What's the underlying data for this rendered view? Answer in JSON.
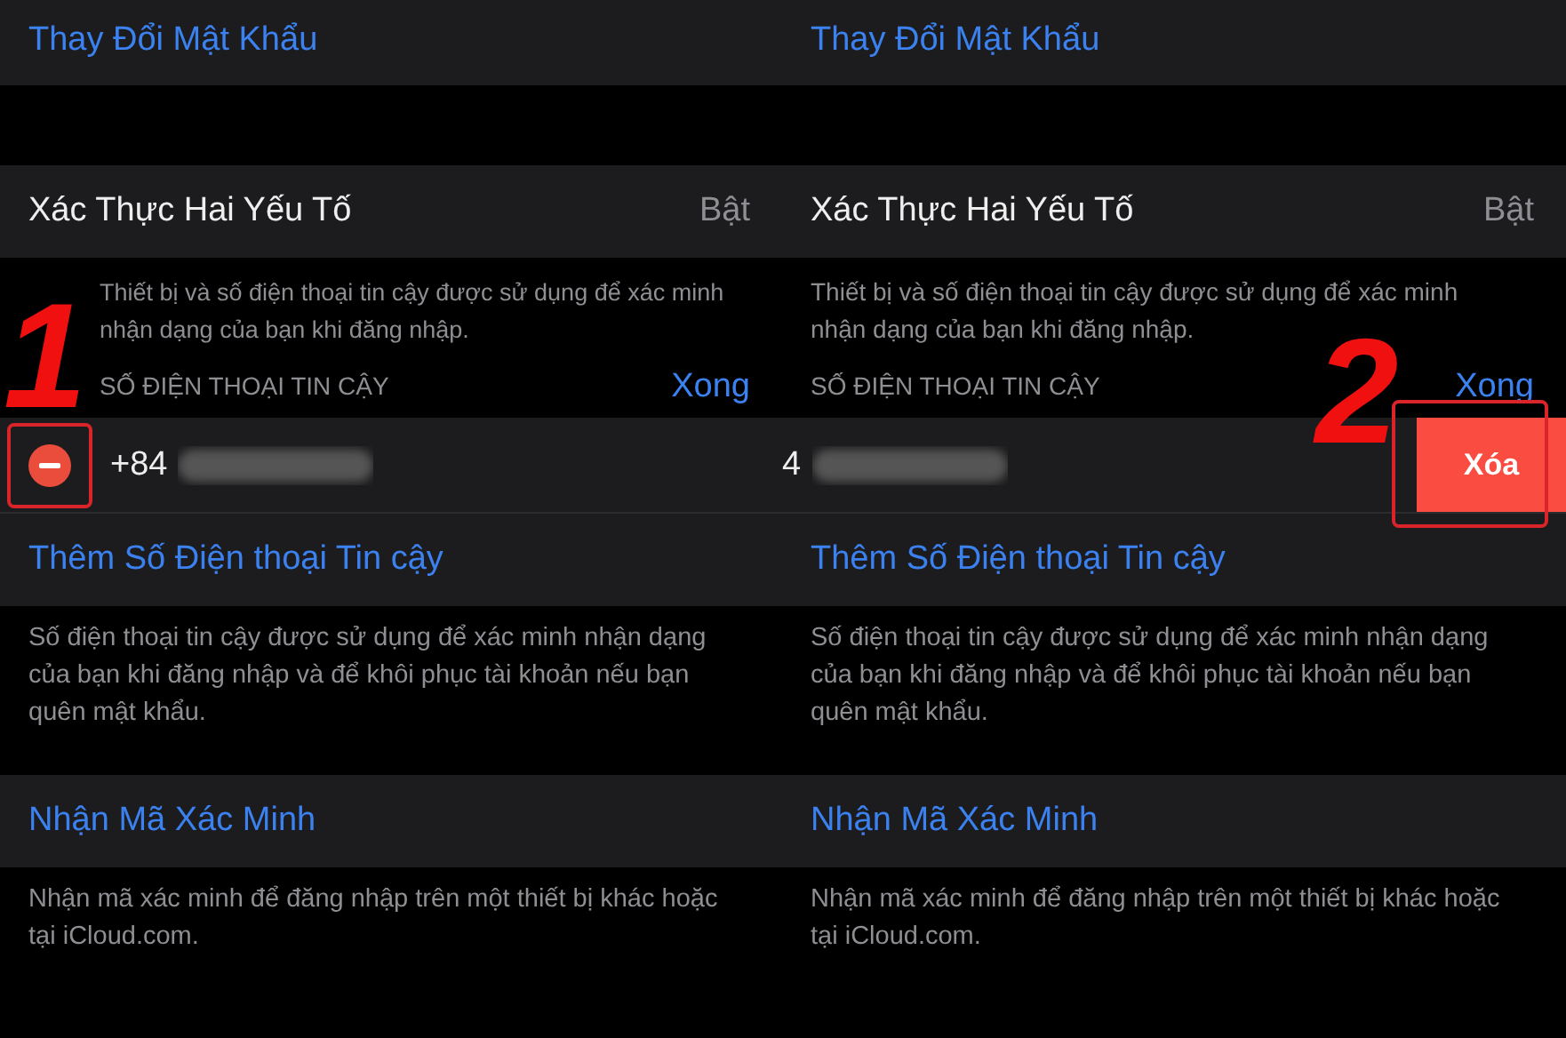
{
  "panels": [
    {
      "annotation": "1",
      "change_password": "Thay Đổi Mật Khẩu",
      "two_factor": {
        "label": "Xác Thực Hai Yếu Tố",
        "value": "Bật"
      },
      "two_factor_note": "Thiết bị và số điện thoại tin cậy được sử dụng để xác minh nhận dạng của bạn khi đăng nhập.",
      "section_header": "SỐ ĐIỆN THOẠI TIN CẬY",
      "done": "Xong",
      "phone_row": {
        "kind": "edit",
        "number": "+84"
      },
      "add_phone": "Thêm Số Điện thoại Tin cậy",
      "add_phone_note": "Số điện thoại tin cậy được sử dụng để xác minh nhận dạng của bạn khi đăng nhập và để khôi phục tài khoản nếu bạn quên mật khẩu.",
      "get_code": "Nhận Mã Xác Minh",
      "get_code_note": "Nhận mã xác minh để đăng nhập trên một thiết bị khác hoặc tại iCloud.com."
    },
    {
      "annotation": "2",
      "change_password": "Thay Đổi Mật Khẩu",
      "two_factor": {
        "label": "Xác Thực Hai Yếu Tố",
        "value": "Bật"
      },
      "two_factor_note": "Thiết bị và số điện thoại tin cậy được sử dụng để xác minh nhận dạng của bạn khi đăng nhập.",
      "section_header": "SỐ ĐIỆN THOẠI TIN CẬY",
      "done": "Xong",
      "phone_row": {
        "kind": "swiped",
        "number": "4",
        "delete": "Xóa"
      },
      "add_phone": "Thêm Số Điện thoại Tin cậy",
      "add_phone_note": "Số điện thoại tin cậy được sử dụng để xác minh nhận dạng của bạn khi đăng nhập và để khôi phục tài khoản nếu bạn quên mật khẩu.",
      "get_code": "Nhận Mã Xác Minh",
      "get_code_note": "Nhận mã xác minh để đăng nhập trên một thiết bị khác hoặc tại iCloud.com."
    }
  ]
}
